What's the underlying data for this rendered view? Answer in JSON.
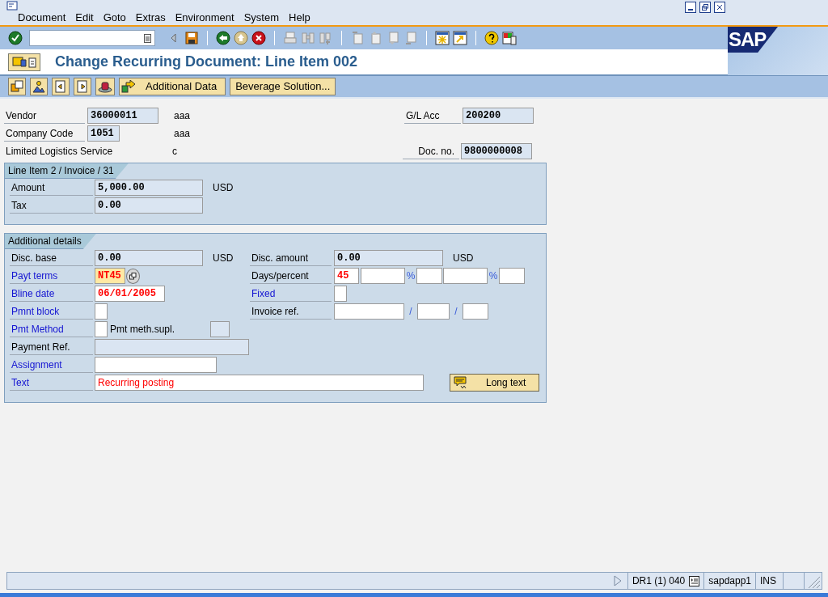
{
  "menu": [
    "Document",
    "Edit",
    "Goto",
    "Extras",
    "Environment",
    "System",
    "Help"
  ],
  "logo": "SAP",
  "title": "Change Recurring Document: Line Item 002",
  "app_toolbar": {
    "buttons": [
      "Additional Data",
      "Beverage Solution..."
    ]
  },
  "header": {
    "vendor": {
      "label": {
        "text": "Vendor",
        "link": false
      },
      "field": {
        "value": "36000011",
        "kind": "display"
      },
      "description": "aaa"
    },
    "company_code": {
      "label": {
        "text": "Company Code",
        "link": false
      },
      "field": {
        "value": "1051",
        "kind": "display"
      },
      "description": "aaa"
    },
    "vendor_name": "Limited Logistics Service",
    "vendor_city": "c",
    "gl_account": {
      "label": {
        "text": "G/L Acc",
        "link": false
      },
      "field": {
        "value": "200200",
        "kind": "display"
      }
    },
    "doc_no": {
      "label": {
        "text": "Doc. no.",
        "link": false
      },
      "field": {
        "value": "9800000008",
        "kind": "display"
      }
    }
  },
  "line_item": {
    "title": "Line Item 2 / Invoice / 31",
    "amount": {
      "label": {
        "text": "Amount",
        "link": false
      },
      "field": {
        "value": "5,000.00",
        "kind": "display"
      },
      "currency": "USD"
    },
    "tax": {
      "label": {
        "text": "Tax",
        "link": false
      },
      "field": {
        "value": "0.00",
        "kind": "display"
      }
    }
  },
  "additional_details": {
    "title": "Additional details",
    "disc_base": {
      "label": {
        "text": "Disc. base",
        "link": false
      },
      "field": {
        "value": "0.00",
        "kind": "display"
      },
      "currency": "USD"
    },
    "disc_amount": {
      "label": {
        "text": "Disc. amount",
        "link": false
      },
      "field": {
        "value": "0.00",
        "kind": "display"
      },
      "currency": "USD"
    },
    "payt_terms": {
      "label": {
        "text": "Payt terms",
        "link": true
      },
      "field": {
        "value": "NT45",
        "kind": "required",
        "modified": true
      }
    },
    "days_percent": {
      "label": {
        "text": "Days/percent",
        "link": false
      },
      "fields": [
        {
          "value": "45",
          "kind": "input",
          "modified": true
        },
        {
          "kind": "input"
        },
        {
          "kind": "input"
        },
        {
          "kind": "input"
        },
        {
          "kind": "input"
        }
      ],
      "separators": [
        "%",
        "%"
      ]
    },
    "bline_date": {
      "label": {
        "text": "Bline date",
        "link": true
      },
      "field": {
        "value": "06/01/2005",
        "kind": "input",
        "modified": true
      }
    },
    "fixed": {
      "label": {
        "text": "Fixed",
        "link": true
      },
      "field": {
        "kind": "input"
      }
    },
    "pmnt_block": {
      "label": {
        "text": "Pmnt block",
        "link": true
      },
      "field": {
        "kind": "input"
      }
    },
    "invoice_ref": {
      "label": {
        "text": "Invoice ref.",
        "link": false
      },
      "fields": [
        {
          "kind": "input"
        },
        {
          "kind": "input"
        },
        {
          "kind": "input"
        }
      ],
      "separators": [
        "/",
        "/"
      ]
    },
    "pmt_method": {
      "label": {
        "text": "Pmt Method",
        "link": true
      },
      "field": {
        "kind": "input"
      }
    },
    "pmt_meth_supl": {
      "label": {
        "text": "Pmt meth.supl.",
        "link": false
      },
      "field": {
        "kind": "display"
      }
    },
    "payment_ref": {
      "label": {
        "text": "Payment Ref.",
        "link": false
      },
      "field": {
        "kind": "display"
      }
    },
    "assignment": {
      "label": {
        "text": "Assignment",
        "link": true
      },
      "field": {
        "kind": "input"
      }
    },
    "text": {
      "label": {
        "text": "Text",
        "link": true
      },
      "field": {
        "value": "Recurring posting",
        "kind": "input",
        "modified": true
      }
    },
    "long_text_button": "Long text"
  },
  "status_bar": {
    "system": "DR1 (1) 040",
    "server": "sapdapp1",
    "mode": "INS"
  }
}
